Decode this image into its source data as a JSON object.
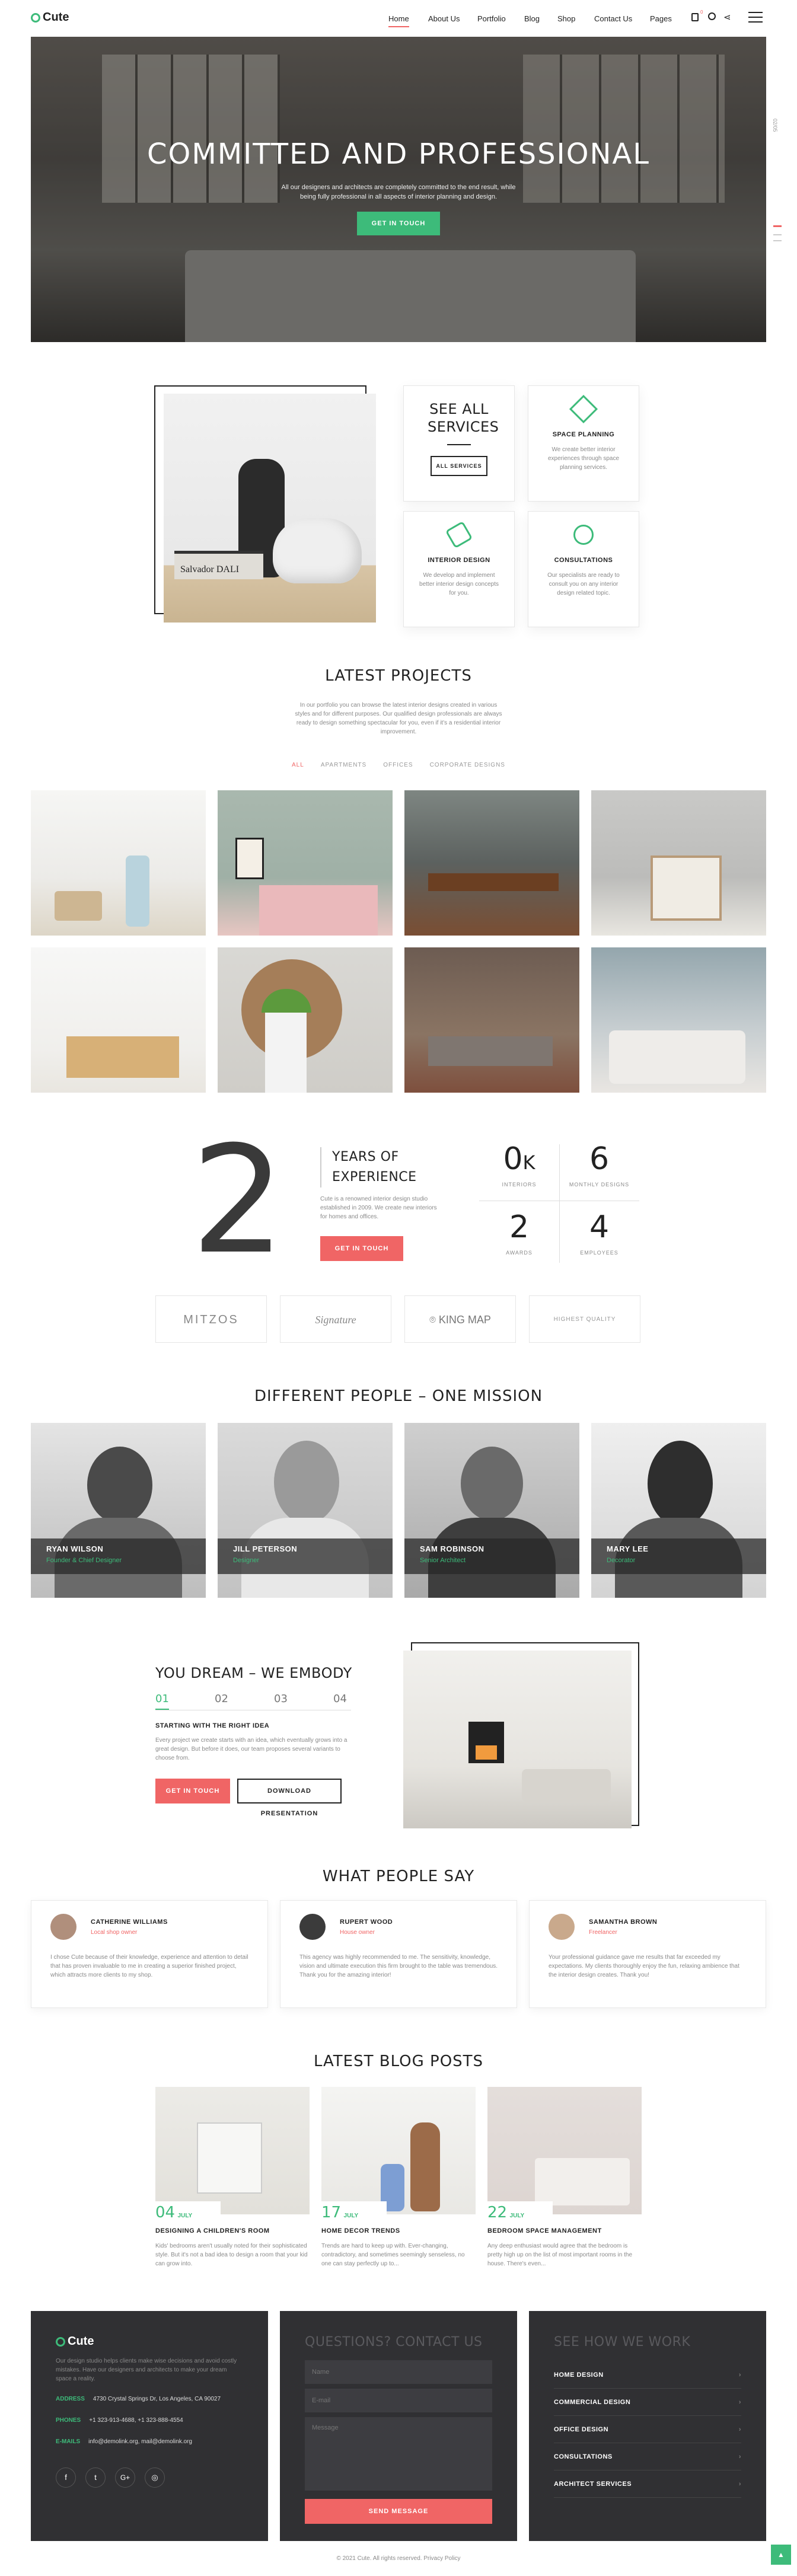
{
  "brand": {
    "name": "Cute",
    "accent": "#3dbb7a",
    "coral": "#f06565",
    "dark": "#303033"
  },
  "nav": {
    "items": [
      "Home",
      "About Us",
      "Portfolio",
      "Blog",
      "Shop",
      "Contact Us",
      "Pages"
    ],
    "active": "Home",
    "cart_count": "0"
  },
  "hero": {
    "title": "COMMITTED AND PROFESSIONAL",
    "text": "All our designers and architects are completely committed to the end result, while being fully professional in all aspects of interior planning and design.",
    "button": "GET IN TOUCH",
    "slide_counter": "02/05"
  },
  "services": {
    "heading": "SEE ALL SERVICES",
    "button": "ALL SERVICES",
    "image_book_text": "Salvador DALI",
    "items": [
      {
        "title": "SPACE PLANNING",
        "text": "We create better interior experiences through space planning services."
      },
      {
        "title": "INTERIOR DESIGN",
        "text": "We develop and implement better interior design concepts for you."
      },
      {
        "title": "CONSULTATIONS",
        "text": "Our specialists are ready to consult you on any interior design related topic."
      }
    ]
  },
  "projects": {
    "title": "LATEST PROJECTS",
    "text": "In our portfolio you can browse the latest interior designs created in various styles and for different purposes. Our qualified design professionals are always ready to design something spectacular for you, even if it's a residential interior improvement.",
    "filters": [
      "ALL",
      "APARTMENTS",
      "OFFICES",
      "CORPORATE DESIGNS"
    ],
    "active_filter": "ALL"
  },
  "stats": {
    "years": "2",
    "years_title": "YEARS OF EXPERIENCE",
    "years_text": "Cute is a renowned interior design studio established in 2009. We create new interiors for homes and offices.",
    "button": "GET IN TOUCH",
    "items": [
      {
        "value": "0",
        "unit": "K",
        "label": "INTERIORS"
      },
      {
        "value": "6",
        "unit": "",
        "label": "MONTHLY DESIGNS"
      },
      {
        "value": "2",
        "unit": "",
        "label": "AWARDS"
      },
      {
        "value": "4",
        "unit": "",
        "label": "EMPLOYEES"
      }
    ]
  },
  "logos": [
    "MITZOS",
    "Signature",
    "KING MAP",
    "HIGHEST QUALITY"
  ],
  "team": {
    "title": "DIFFERENT PEOPLE – ONE MISSION",
    "members": [
      {
        "name": "RYAN WILSON",
        "role": "Founder & Chief Designer"
      },
      {
        "name": "JILL PETERSON",
        "role": "Designer"
      },
      {
        "name": "SAM ROBINSON",
        "role": "Senior Architect"
      },
      {
        "name": "MARY LEE",
        "role": "Decorator"
      }
    ]
  },
  "dream": {
    "title": "YOU DREAM – WE EMBODY",
    "tabs": [
      "01",
      "02",
      "03",
      "04"
    ],
    "active_tab": "01",
    "subtitle": "STARTING WITH THE RIGHT IDEA",
    "text": "Every project we create starts with an idea, which eventually grows into a great design. But before it does, our team proposes several variants to choose from.",
    "btn1": "GET IN TOUCH",
    "btn2": "DOWNLOAD PRESENTATION"
  },
  "testimonials": {
    "title": "WHAT PEOPLE SAY",
    "items": [
      {
        "name": "CATHERINE WILLIAMS",
        "role": "Local shop owner",
        "text": "I chose Cute because of their knowledge, experience and attention to detail that has proven invaluable to me in creating a superior finished project, which attracts more clients to my shop."
      },
      {
        "name": "RUPERT WOOD",
        "role": "House owner",
        "text": "This agency was highly recommended to me. The sensitivity, knowledge, vision and ultimate execution this firm brought to the table was tremendous. Thank you for the amazing interior!"
      },
      {
        "name": "SAMANTHA BROWN",
        "role": "Freelancer",
        "text": "Your professional guidance gave me results that far exceeded my expectations. My clients thoroughly enjoy the fun, relaxing ambience that the interior design creates. Thank you!"
      }
    ]
  },
  "blog": {
    "title": "LATEST BLOG POSTS",
    "posts": [
      {
        "day": "04",
        "month": "JULY",
        "title": "DESIGNING A CHILDREN'S ROOM",
        "text": "Kids' bedrooms aren't usually noted for their sophisticated style. But it's not a bad idea to design a room that your kid can grow into."
      },
      {
        "day": "17",
        "month": "JULY",
        "title": "HOME DECOR TRENDS",
        "text": "Trends are hard to keep up with. Ever-changing, contradictory, and sometimes seemingly senseless, no one can stay perfectly up to..."
      },
      {
        "day": "22",
        "month": "JULY",
        "title": "BEDROOM SPACE MANAGEMENT",
        "text": "Any deep enthusiast would agree that the bedroom is pretty high up on the list of most important rooms in the house. There's even..."
      }
    ]
  },
  "footer": {
    "about": "Our design studio helps clients make wise decisions and avoid costly mistakes. Have our designers and architects to make your dream space a reality.",
    "address_label": "ADDRESS",
    "address": "4730 Crystal Springs Dr, Los Angeles, CA 90027",
    "phones_label": "PHONES",
    "phones": "+1 323-913-4688, +1 323-888-4554",
    "email_label": "E-MAILS",
    "email": "info@demolink.org, mail@demolink.org",
    "contact_title": "QUESTIONS? CONTACT US",
    "name_ph": "Name",
    "email_ph": "E-mail",
    "message_ph": "Message",
    "send": "SEND MESSAGE",
    "work_title": "SEE HOW WE WORK",
    "work_items": [
      "HOME DESIGN",
      "COMMERCIAL DESIGN",
      "OFFICE DESIGN",
      "CONSULTATIONS",
      "ARCHITECT SERVICES"
    ],
    "copyright": "© 2021 Cute. All rights reserved. Privacy Policy"
  }
}
